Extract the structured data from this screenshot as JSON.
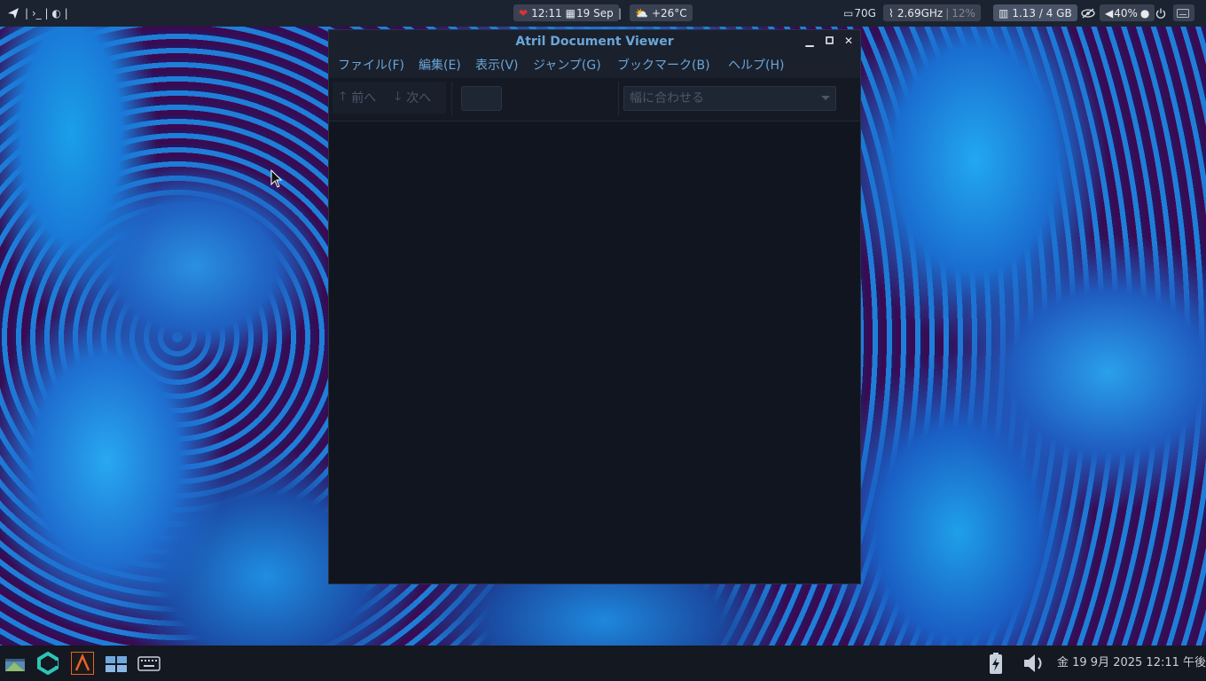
{
  "top_panel": {
    "left_glyphs": "| ›_ | ◐ |",
    "clock": {
      "time": "12:11",
      "date": "19 Sep"
    },
    "divider": "|",
    "weather": {
      "temp": "+26°C"
    },
    "disk": "70G",
    "cpu": {
      "freq": "2.69GHz",
      "sep": "|",
      "load": "12%"
    },
    "memory": "1.13 / 4 GB",
    "volume": "40%"
  },
  "window": {
    "title": "Atril Document Viewer",
    "menu": [
      "ファイル(F)",
      "編集(E)",
      "表示(V)",
      "ジャンプ(G)",
      "ブックマーク(B)",
      "ヘルプ(H)"
    ],
    "toolbar": {
      "prev_label": "前へ",
      "next_label": "次へ",
      "page_value": "",
      "zoom_value": "幅に合わせる"
    }
  },
  "taskbar": {
    "clock": "金 19  9月 2025 12:11 午後"
  },
  "colors": {
    "accent": "#6aa6d8",
    "panel_bg": "#1c2330",
    "window_bg": "#11151f",
    "disabled_text": "#4c5668"
  }
}
